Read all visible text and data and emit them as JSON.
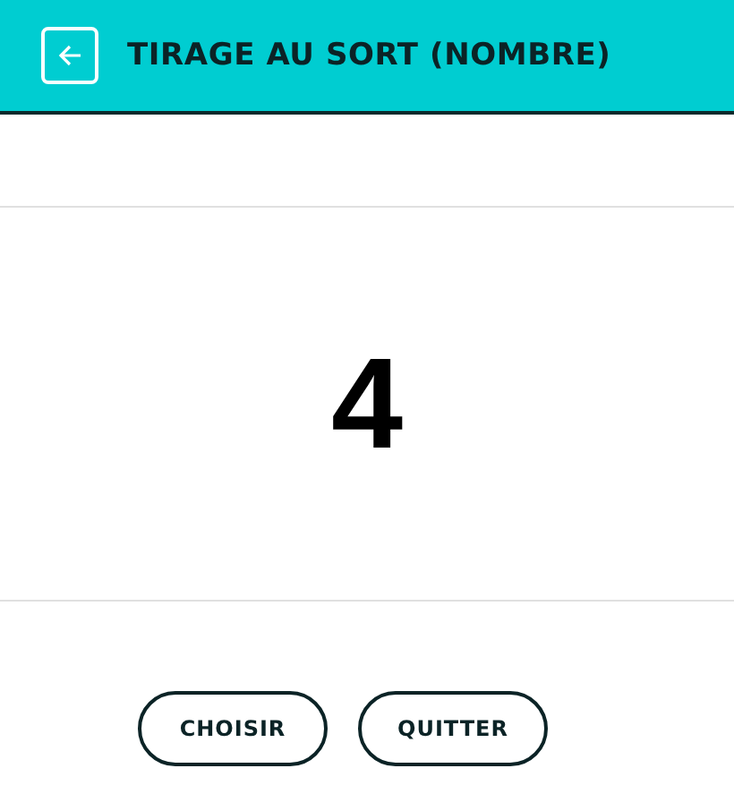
{
  "header": {
    "title": "TIRAGE AU SORT (NOMBRE)"
  },
  "result": "4",
  "buttons": [
    "CHOISIR",
    "QUITTER"
  ]
}
